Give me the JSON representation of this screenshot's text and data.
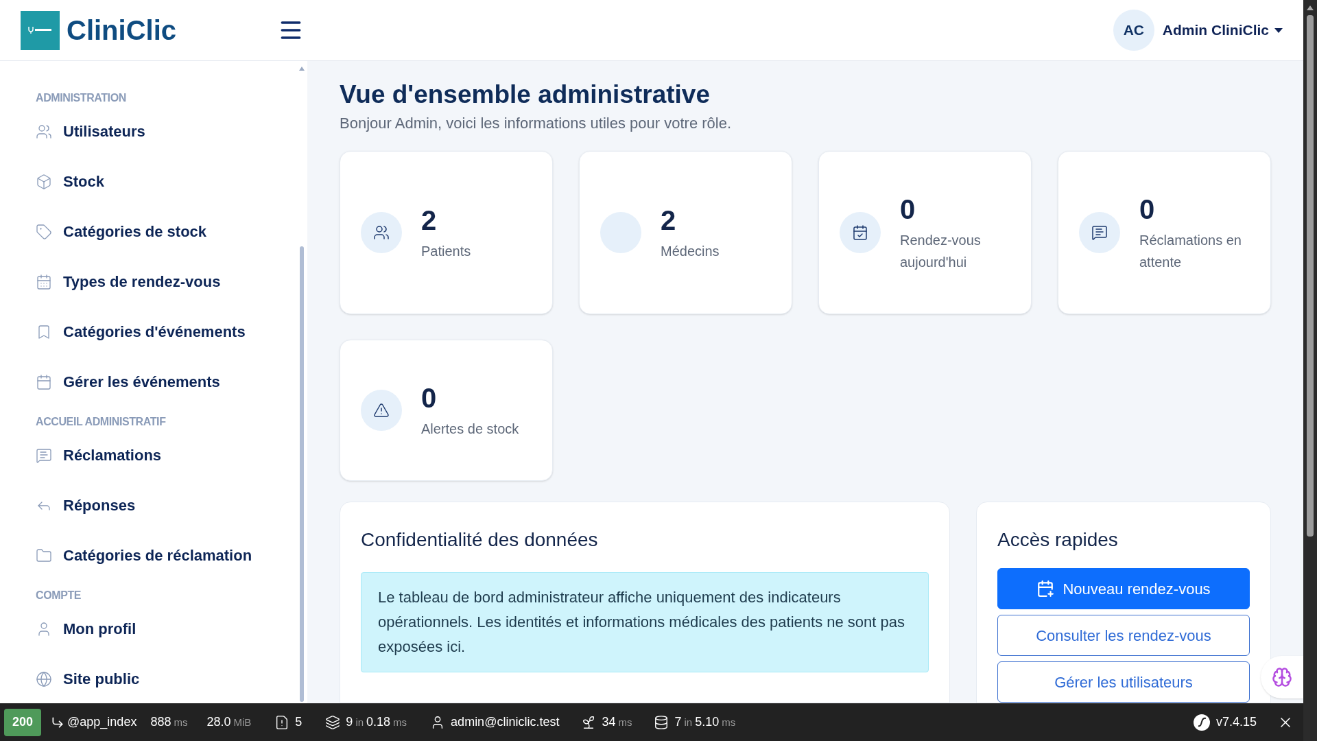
{
  "header": {
    "brand": "CliniClic",
    "user": {
      "initials": "AC",
      "name": "Admin CliniClic"
    }
  },
  "sidebar": {
    "sections": [
      {
        "title": "ADMINISTRATION",
        "items": [
          {
            "label": "Utilisateurs"
          },
          {
            "label": "Stock"
          },
          {
            "label": "Catégories de stock"
          },
          {
            "label": "Types de rendez-vous"
          },
          {
            "label": "Catégories d'événements"
          },
          {
            "label": "Gérer les événements"
          }
        ]
      },
      {
        "title": "ACCUEIL ADMINISTRATIF",
        "items": [
          {
            "label": "Réclamations"
          },
          {
            "label": "Réponses"
          },
          {
            "label": "Catégories de réclamation"
          }
        ]
      },
      {
        "title": "COMPTE",
        "items": [
          {
            "label": "Mon profil"
          },
          {
            "label": "Site public"
          }
        ]
      }
    ]
  },
  "page": {
    "title": "Vue d'ensemble administrative",
    "subtitle": "Bonjour Admin, voici les informations utiles pour votre rôle."
  },
  "stats": [
    {
      "value": "2",
      "label": "Patients"
    },
    {
      "value": "2",
      "label": "Médecins"
    },
    {
      "value": "0",
      "label": "Rendez-vous aujourd'hui"
    },
    {
      "value": "0",
      "label": "Réclamations en attente"
    },
    {
      "value": "0",
      "label": "Alertes de stock"
    }
  ],
  "privacy": {
    "title": "Confidentialité des données",
    "text": "Le tableau de bord administrateur affiche uniquement des indicateurs opérationnels. Les identités et informations médicales des patients ne sont pas exposées ici."
  },
  "quick_access": {
    "title": "Accès rapides",
    "buttons": [
      {
        "label": "Nouveau rendez-vous",
        "kind": "primary"
      },
      {
        "label": "Consulter les rendez-vous",
        "kind": "outline"
      },
      {
        "label": "Gérer les utilisateurs",
        "kind": "outline"
      }
    ]
  },
  "debug_toolbar": {
    "status": "200",
    "route": "@app_index",
    "time": {
      "value": "888",
      "unit": "ms"
    },
    "memory": {
      "value": "28.0",
      "unit": "MiB"
    },
    "logs": "5",
    "cache": {
      "count": "9",
      "sep": "in",
      "value": "0.18",
      "unit": "ms"
    },
    "user": "admin@cliniclic.test",
    "twig": {
      "value": "34",
      "unit": "ms"
    },
    "db": {
      "count": "7",
      "sep": "in",
      "value": "5.10",
      "unit": "ms"
    },
    "version": "v7.4.15"
  }
}
